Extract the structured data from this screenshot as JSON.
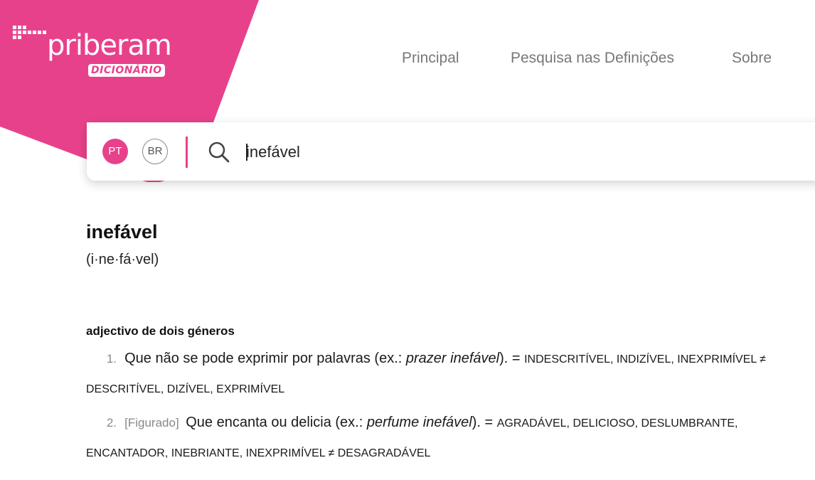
{
  "brand": {
    "logo_text": "priberam",
    "logo_sub": "DICIONÁRIO",
    "accent_color": "#e8418b"
  },
  "nav": {
    "items": [
      "Principal",
      "Pesquisa nas Definições",
      "Sobre"
    ]
  },
  "search": {
    "lang_pt": "PT",
    "lang_br": "BR",
    "value": "inefável"
  },
  "entry": {
    "headword": "inefável",
    "syllables": "(i·ne·fá·vel)",
    "part_of_speech": "adjectivo de dois géneros",
    "definitions": [
      {
        "number": "1.",
        "text": "Que não se pode exprimir por palavras (ex.: ",
        "example": "prazer inefável",
        "after": "). = ",
        "synonyms": "INDESCRITÍVEL, INDIZÍVEL, INEXPRIMÍVEL ≠ DESCRITÍVEL, DIZÍVEL, EXPRIMÍVEL"
      },
      {
        "number": "2.",
        "tag": "[Figurado]",
        "text": "Que encanta ou delicia (ex.: ",
        "example": "perfume inefável",
        "after": "). = ",
        "synonyms": "AGRADÁVEL, DELICIOSO, DESLUMBRANTE, ENCANTADOR, INEBRIANTE, INEXPRIMÍVEL ≠ DESAGRADÁVEL"
      }
    ]
  }
}
